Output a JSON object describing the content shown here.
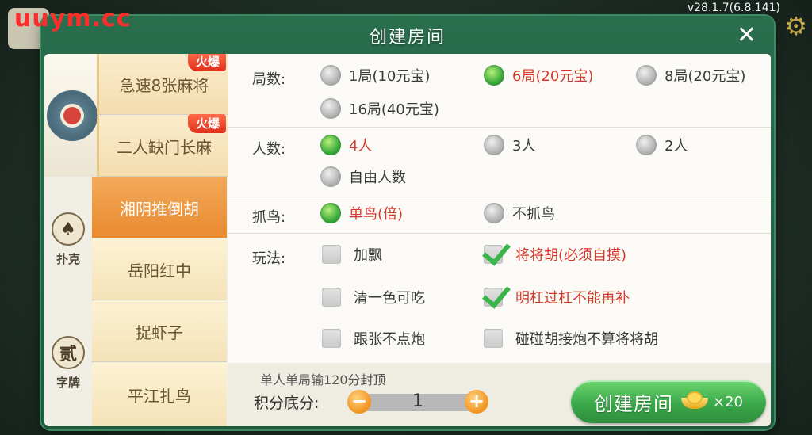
{
  "brand": "uuym.cc",
  "version": "v28.1.7(6.8.141)",
  "dialog": {
    "title": "创建房间"
  },
  "rail": [
    {
      "label": ""
    },
    {
      "label": "扑克",
      "glyph": "♠"
    },
    {
      "label": "字牌",
      "glyph": "贰"
    }
  ],
  "games": [
    {
      "name": "急速8张麻将",
      "badge": "火爆",
      "active": false
    },
    {
      "name": "二人缺门长麻",
      "badge": "火爆",
      "active": false
    },
    {
      "name": "湘阴推倒胡",
      "badge": "",
      "active": true
    },
    {
      "name": "岳阳红中",
      "badge": "",
      "active": false
    },
    {
      "name": "捉虾子",
      "badge": "",
      "active": false
    },
    {
      "name": "平江扎鸟",
      "badge": "",
      "active": false
    }
  ],
  "rounds": {
    "label": "局数:",
    "options": [
      "1局(10元宝)",
      "6局(20元宝)",
      "8局(20元宝)",
      "16局(40元宝)"
    ],
    "selected": 1
  },
  "players": {
    "label": "人数:",
    "options": [
      "4人",
      "3人",
      "2人",
      "自由人数"
    ],
    "selected": 0
  },
  "birds": {
    "label": "抓鸟:",
    "options": [
      "单鸟(倍)",
      "不抓鸟"
    ],
    "selected": 0
  },
  "rules": {
    "label": "玩法:",
    "options": [
      {
        "text": "加飘",
        "checked": false
      },
      {
        "text": "将将胡(必须自摸)",
        "checked": true
      },
      {
        "text": "清一色可吃",
        "checked": false
      },
      {
        "text": "明杠过杠不能再补",
        "checked": true
      },
      {
        "text": "跟张不点炮",
        "checked": false
      },
      {
        "text": "碰碰胡接炮不算将将胡",
        "checked": false
      }
    ]
  },
  "footer": {
    "cap": "单人单局输120分封顶",
    "score_label": "积分底分:",
    "score_value": "1",
    "minus": "−",
    "plus": "+",
    "create_label": "创建房间",
    "cost": "×20"
  },
  "colors": {
    "accent_green": "#3aa84a",
    "selected_red": "#d33a2c",
    "active_orange": "#e98a2f"
  }
}
